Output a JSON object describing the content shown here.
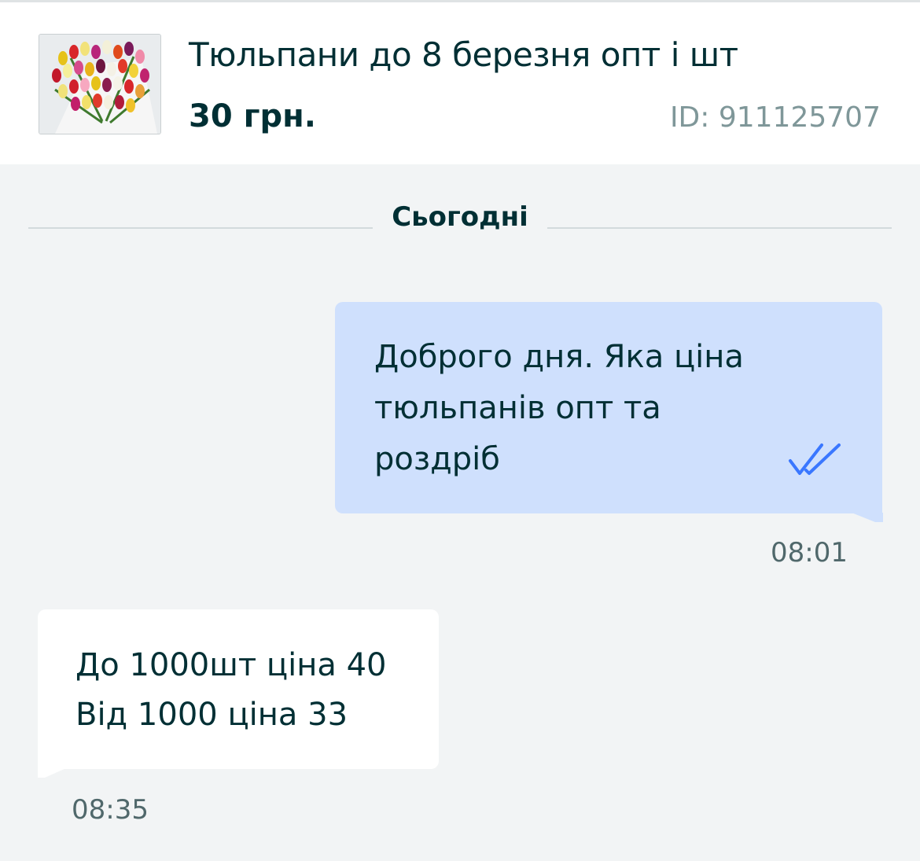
{
  "listing": {
    "title": "Тюльпани до 8 березня опт і шт",
    "price": "30 грн.",
    "id_label": "ID: 911125707"
  },
  "chat": {
    "day_separator": "Сьогодні",
    "messages": [
      {
        "direction": "outgoing",
        "lines": [
          "Доброго дня. Яка ціна",
          "тюльпанів опт та",
          "роздріб"
        ],
        "time": "08:01",
        "status_icon": "double-check-icon"
      },
      {
        "direction": "incoming",
        "lines": [
          "До 1000шт ціна 40",
          "Від 1000 ціна 33"
        ],
        "time": "08:35"
      }
    ]
  },
  "colors": {
    "background": "#f2f4f5",
    "outgoing_bubble": "#cfe0fd",
    "incoming_bubble": "#ffffff",
    "text": "#002f34",
    "accent": "#3a77ff"
  }
}
